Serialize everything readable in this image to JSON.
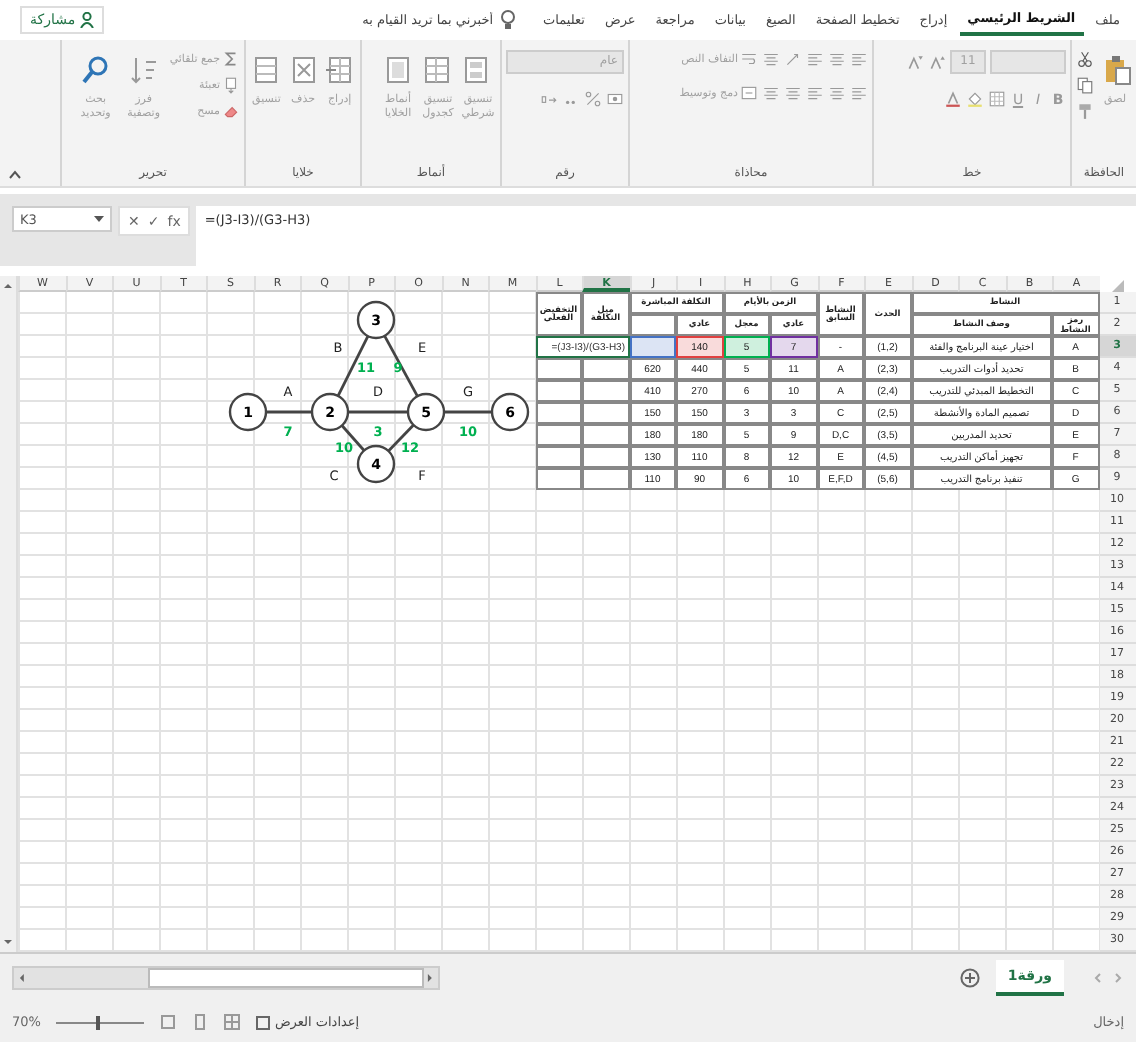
{
  "window": {
    "share_button": "مشاركة"
  },
  "tabs": [
    {
      "label": "ملف",
      "selected": false
    },
    {
      "label": "الشريط الرئيسي",
      "selected": true
    },
    {
      "label": "إدراج",
      "selected": false
    },
    {
      "label": "تخطيط الصفحة",
      "selected": false
    },
    {
      "label": "الصيغ",
      "selected": false
    },
    {
      "label": "بيانات",
      "selected": false
    },
    {
      "label": "مراجعة",
      "selected": false
    },
    {
      "label": "عرض",
      "selected": false
    },
    {
      "label": "تعليمات",
      "selected": false
    }
  ],
  "tell_me": {
    "placeholder": "أخبرني بما تريد القيام به"
  },
  "ribbon": {
    "disabled": true,
    "groups": [
      {
        "kind": "clipboard",
        "label": "الحافظة",
        "buttons": [
          "لصق"
        ]
      },
      {
        "kind": "font",
        "label": "خط",
        "font_size": "11",
        "format_buttons": [
          "B",
          "I",
          "U"
        ]
      },
      {
        "kind": "alignment",
        "label": "محاذاة",
        "buttons": [
          "التفاف النص",
          "دمج وتوسيط"
        ]
      },
      {
        "kind": "number",
        "label": "رقم",
        "format": "عام"
      },
      {
        "kind": "styles",
        "label": "أنماط",
        "buttons": [
          "تنسيق شرطي",
          "تنسيق كجدول",
          "أنماط الخلايا"
        ]
      },
      {
        "kind": "cells",
        "label": "خلايا",
        "buttons": [
          "إدراج",
          "حذف",
          "تنسيق"
        ]
      },
      {
        "kind": "editing",
        "label": "تحرير",
        "buttons": [
          "جمع تلقائي",
          "تعبئة",
          "مسح",
          "فرز وتصفية",
          "بحث وتحديد"
        ]
      }
    ]
  },
  "formula_bar": {
    "name_box": "K3",
    "buttons": [
      "fx",
      "✓",
      "✕"
    ],
    "formula": "=(J3-I3)/(G3-H3)"
  },
  "column_headers": [
    {
      "label": "A",
      "selected": false
    },
    {
      "label": "B",
      "selected": false
    },
    {
      "label": "C",
      "selected": false
    },
    {
      "label": "D",
      "selected": false
    },
    {
      "label": "E",
      "selected": false
    },
    {
      "label": "F",
      "selected": false
    },
    {
      "label": "G",
      "selected": false
    },
    {
      "label": "H",
      "selected": false
    },
    {
      "label": "I",
      "selected": false
    },
    {
      "label": "J",
      "selected": false
    },
    {
      "label": "K",
      "selected": true
    },
    {
      "label": "L",
      "selected": false
    },
    {
      "label": "M",
      "selected": false
    },
    {
      "label": "N",
      "selected": false
    },
    {
      "label": "O",
      "selected": false
    },
    {
      "label": "P",
      "selected": false
    },
    {
      "label": "Q",
      "selected": false
    },
    {
      "label": "R",
      "selected": false
    },
    {
      "label": "S",
      "selected": false
    },
    {
      "label": "T",
      "selected": false
    },
    {
      "label": "U",
      "selected": false
    },
    {
      "label": "V",
      "selected": false
    },
    {
      "label": "W",
      "selected": false
    }
  ],
  "row_headers": [
    {
      "label": "1",
      "selected": false
    },
    {
      "label": "2",
      "selected": false
    },
    {
      "label": "3",
      "selected": true
    },
    {
      "label": "4",
      "selected": false
    },
    {
      "label": "5",
      "selected": false
    },
    {
      "label": "6",
      "selected": false
    },
    {
      "label": "7",
      "selected": false
    },
    {
      "label": "8",
      "selected": false
    },
    {
      "label": "9",
      "selected": false
    },
    {
      "label": "10",
      "selected": false
    },
    {
      "label": "11",
      "selected": false
    },
    {
      "label": "12",
      "selected": false
    },
    {
      "label": "13",
      "selected": false
    },
    {
      "label": "14",
      "selected": false
    },
    {
      "label": "15",
      "selected": false
    },
    {
      "label": "16",
      "selected": false
    },
    {
      "label": "17",
      "selected": false
    },
    {
      "label": "18",
      "selected": false
    },
    {
      "label": "19",
      "selected": false
    },
    {
      "label": "20",
      "selected": false
    },
    {
      "label": "21",
      "selected": false
    },
    {
      "label": "22",
      "selected": false
    },
    {
      "label": "23",
      "selected": false
    },
    {
      "label": "24",
      "selected": false
    },
    {
      "label": "25",
      "selected": false
    },
    {
      "label": "26",
      "selected": false
    },
    {
      "label": "27",
      "selected": false
    },
    {
      "label": "28",
      "selected": false
    },
    {
      "label": "29",
      "selected": false
    },
    {
      "label": "30",
      "selected": false
    }
  ],
  "table": {
    "headers": [
      "النشاط",
      "الحدث",
      "النشاط السابق",
      "الزمن بالأيام",
      "التكلفة المباشرة",
      "ميل التكلفة",
      "التخفيض الفعلي"
    ],
    "subheaders": [
      "رمز النشاط",
      "وصف النشاط",
      "عادي",
      "معجل",
      "عادي"
    ],
    "rows": [
      {
        "code": "A",
        "description": "اختيار عينة البرنامج والفئة",
        "event": "(1,2)",
        "predecessor": "-",
        "normal_time": "7",
        "crash_time": "5",
        "normal_cost": "140",
        "editing": true,
        "cost_slope": "=(J3-I3)/(G3-H3)"
      },
      {
        "code": "B",
        "description": "تحديد أدوات التدريب",
        "event": "(2,3)",
        "predecessor": "A",
        "normal_time": "11",
        "crash_time": "5",
        "normal_cost": "440",
        "crash_cost": "620",
        "editing": false
      },
      {
        "code": "C",
        "description": "التخطيط المبدئي للتدريب",
        "event": "(2,4)",
        "predecessor": "A",
        "normal_time": "10",
        "crash_time": "6",
        "normal_cost": "270",
        "crash_cost": "410",
        "editing": false
      },
      {
        "code": "D",
        "description": "تصميم المادة والأنشطة",
        "event": "(2,5)",
        "predecessor": "C",
        "normal_time": "3",
        "crash_time": "3",
        "normal_cost": "150",
        "crash_cost": "150",
        "editing": false
      },
      {
        "code": "E",
        "description": "تحديد المدربين",
        "event": "(3,5)",
        "predecessor": "D,C",
        "normal_time": "9",
        "crash_time": "5",
        "normal_cost": "180",
        "crash_cost": "180",
        "editing": false
      },
      {
        "code": "F",
        "description": "تجهيز أماكن التدريب",
        "event": "(4,5)",
        "predecessor": "E",
        "normal_time": "12",
        "crash_time": "8",
        "normal_cost": "110",
        "crash_cost": "130",
        "editing": false
      },
      {
        "code": "G",
        "description": "تنفيذ برنامج التدريب",
        "event": "(5,6)",
        "predecessor": "E,F,D",
        "normal_time": "10",
        "crash_time": "6",
        "normal_cost": "90",
        "crash_cost": "110",
        "editing": false
      }
    ]
  },
  "formula_references": [
    {
      "color": "#7030a0"
    },
    {
      "color": "#00b050"
    },
    {
      "color": "#e04040"
    },
    {
      "color": "#4472c4"
    }
  ],
  "network": {
    "nodes": [
      "6",
      "5",
      "4",
      "3",
      "2",
      "1"
    ],
    "edges": [
      {
        "activity": "A",
        "duration": "7"
      },
      {
        "activity": "B",
        "duration": "11"
      },
      {
        "activity": "C",
        "duration": "10"
      },
      {
        "activity": "D",
        "duration": "3"
      },
      {
        "activity": "E",
        "duration": "9"
      },
      {
        "activity": "F",
        "duration": "12"
      },
      {
        "activity": "G",
        "duration": "10"
      }
    ]
  },
  "sheet_tabs": [
    {
      "label": "ورقة1",
      "selected": true
    }
  ],
  "status_bar": {
    "mode": "إدخال",
    "display_settings": "إعدادات العرض",
    "zoom": "70%",
    "zoom_slider": {
      "level": 0.45
    }
  }
}
